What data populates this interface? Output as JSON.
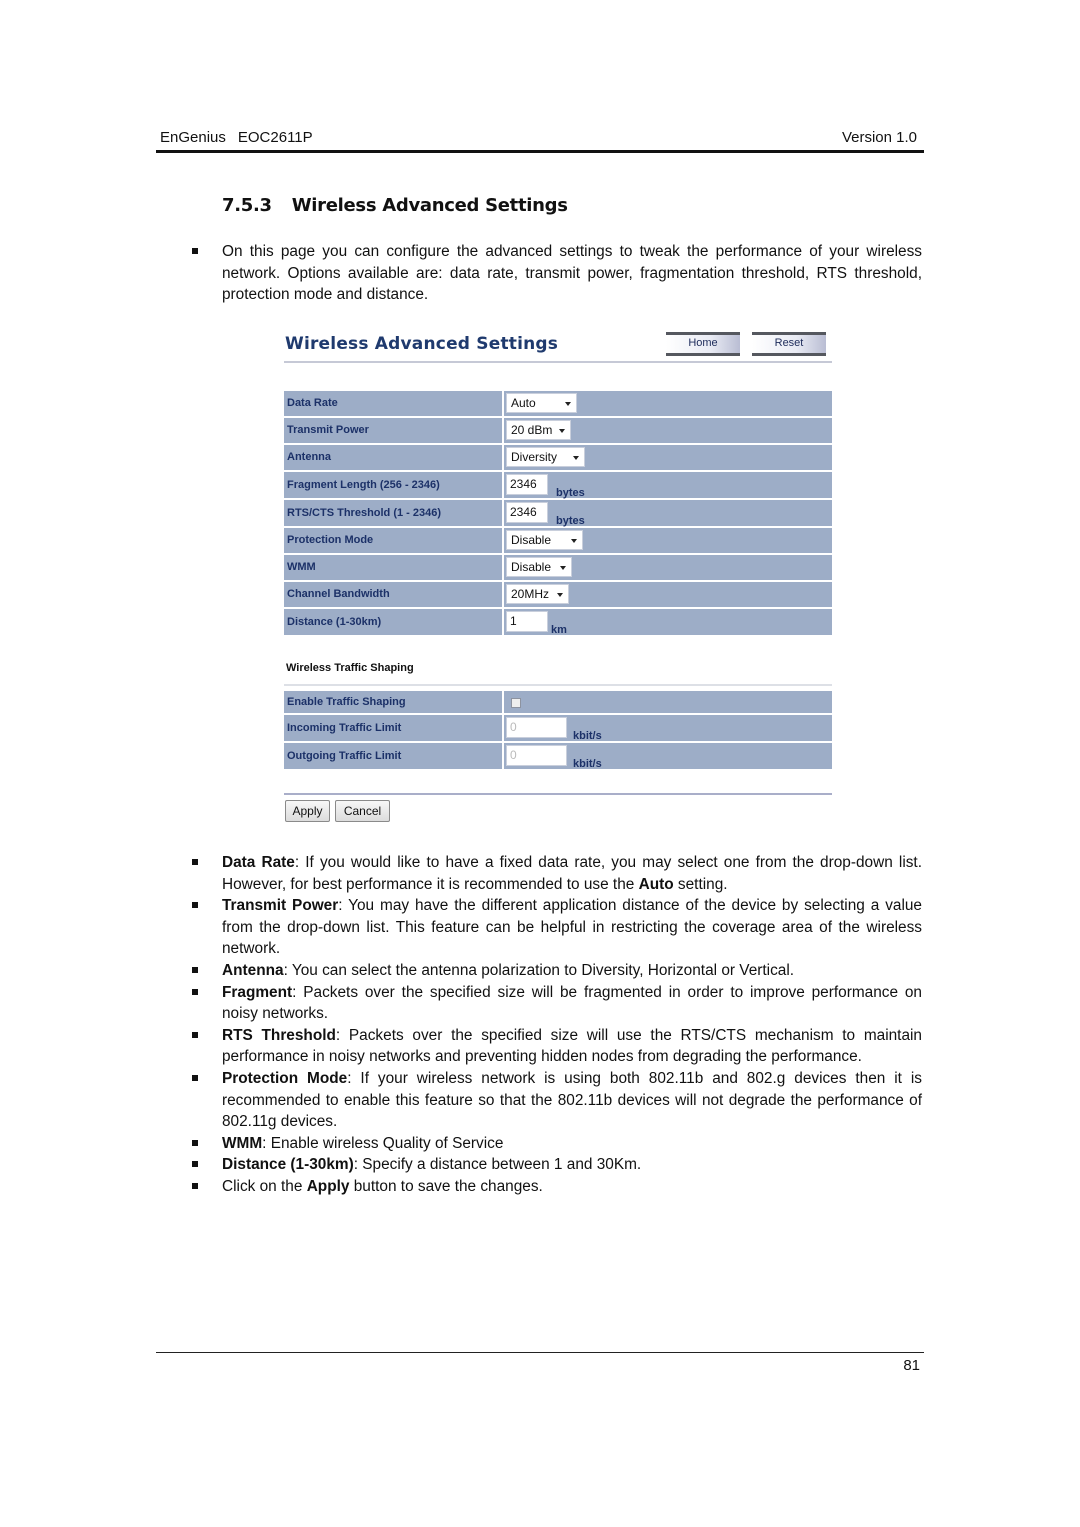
{
  "header": {
    "brand": "EnGenius",
    "model": "EOC2611P",
    "version": "Version 1.0"
  },
  "section": {
    "number": "7.5.3",
    "title": "Wireless Advanced Settings"
  },
  "intro": "On this page you can configure the advanced settings to tweak the performance of your wireless network. Options available are: data rate, transmit power, fragmentation threshold, RTS threshold, protection mode and distance.",
  "screenshot": {
    "title": "Wireless Advanced Settings",
    "nav_buttons": {
      "home": "Home",
      "reset": "Reset"
    },
    "fields": [
      {
        "label": "Data Rate",
        "type": "select",
        "value": "Auto"
      },
      {
        "label": "Transmit Power",
        "type": "select",
        "value": "20 dBm"
      },
      {
        "label": "Antenna",
        "type": "select",
        "value": "Diversity"
      },
      {
        "label": "Fragment Length (256 - 2346)",
        "type": "text",
        "value": "2346",
        "unit": "bytes"
      },
      {
        "label": "RTS/CTS Threshold (1 - 2346)",
        "type": "text",
        "value": "2346",
        "unit": "bytes"
      },
      {
        "label": "Protection Mode",
        "type": "select",
        "value": "Disable"
      },
      {
        "label": "WMM",
        "type": "select",
        "value": "Disable"
      },
      {
        "label": "Channel Bandwidth",
        "type": "select",
        "value": "20MHz"
      },
      {
        "label": "Distance (1-30km)",
        "type": "text",
        "value": "1",
        "unit": "km"
      }
    ],
    "traffic_shaping": {
      "title": "Wireless Traffic Shaping",
      "fields": [
        {
          "label": "Enable Traffic Shaping",
          "type": "checkbox",
          "checked": false
        },
        {
          "label": "Incoming Traffic Limit",
          "type": "text",
          "value": "0",
          "unit": "kbit/s"
        },
        {
          "label": "Outgoing Traffic Limit",
          "type": "text",
          "value": "0",
          "unit": "kbit/s"
        }
      ]
    },
    "actions": {
      "apply": "Apply",
      "cancel": "Cancel"
    }
  },
  "details": [
    {
      "term": "Data Rate",
      "pre": ": If you would like to have a fixed data rate, you may select one from the drop-down list. However, for best performance it is recommended to use the ",
      "bold2": "Auto",
      "post": " setting."
    },
    {
      "term": "Transmit Power",
      "pre": ": You may have the different application distance of the device by selecting a value from the drop-down list. This feature can be helpful in restricting the coverage area of the wireless network."
    },
    {
      "term": "Antenna",
      "pre": ": You can select the antenna polarization to Diversity, Horizontal or Vertical."
    },
    {
      "term": "Fragment",
      "pre": ": Packets over the specified size will be fragmented in order to improve performance on noisy networks."
    },
    {
      "term": "RTS Threshold",
      "pre": ": Packets over the specified size will use the RTS/CTS mechanism to maintain performance in noisy networks and preventing hidden nodes from degrading the performance."
    },
    {
      "term": "Protection Mode",
      "pre": ": If your wireless network is using both 802.11b and 802.g devices then it is recommended to enable this feature so that the 802.11b devices will not degrade the performance of 802.11g devices."
    },
    {
      "term": "WMM",
      "pre": ": Enable wireless Quality of Service"
    },
    {
      "term": "Distance (1-30km)",
      "pre": ": Specify a distance between 1 and 30Km."
    },
    {
      "lead": "Click on the ",
      "term": "Apply",
      "pre": " button to save the changes."
    }
  ],
  "footer": {
    "page_number": "81"
  }
}
